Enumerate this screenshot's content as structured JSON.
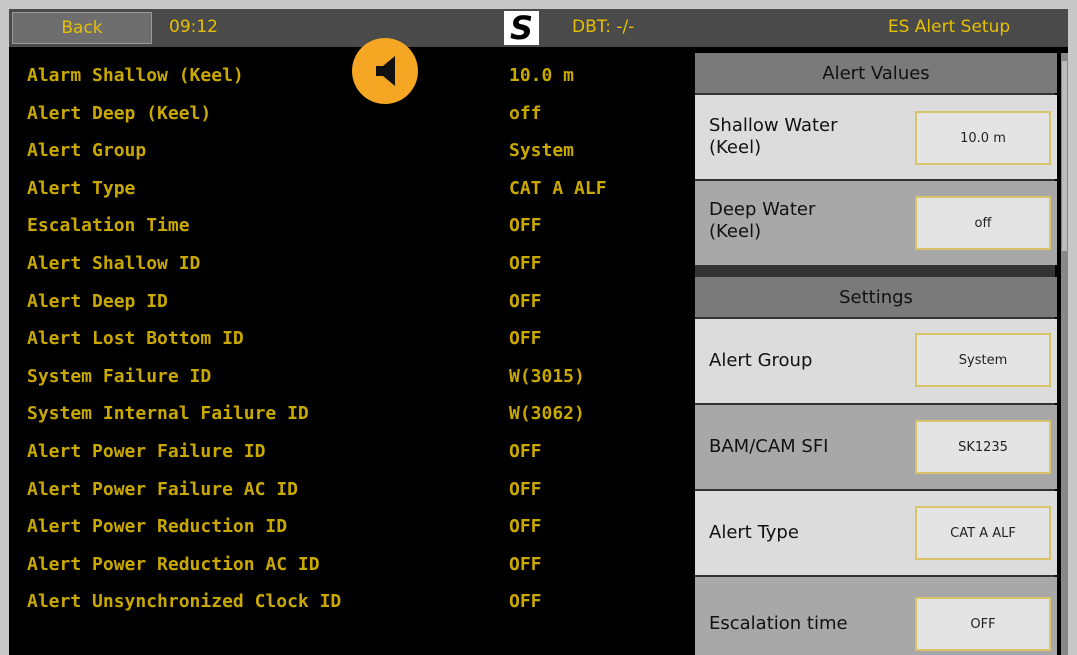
{
  "topbar": {
    "back_label": "Back",
    "time": "09:12",
    "logo": "S",
    "dbt": "DBT: -/-",
    "title": "ES Alert Setup"
  },
  "speaker": {
    "icon": "speaker-icon",
    "color": "#f5a623"
  },
  "list": [
    {
      "label": "Alarm Shallow (Keel)",
      "value": "10.0 m"
    },
    {
      "label": "Alert Deep (Keel)",
      "value": "off"
    },
    {
      "label": "Alert Group",
      "value": "System"
    },
    {
      "label": "Alert Type",
      "value": "CAT A ALF"
    },
    {
      "label": "Escalation Time",
      "value": "OFF"
    },
    {
      "label": "Alert Shallow ID",
      "value": "OFF"
    },
    {
      "label": "Alert Deep ID",
      "value": "OFF"
    },
    {
      "label": "Alert Lost Bottom ID",
      "value": "OFF"
    },
    {
      "label": "System Failure ID",
      "value": "W(3015)"
    },
    {
      "label": "System Internal Failure ID",
      "value": "W(3062)"
    },
    {
      "label": "Alert Power Failure ID",
      "value": "OFF"
    },
    {
      "label": "Alert Power Failure AC ID",
      "value": "OFF"
    },
    {
      "label": "Alert Power Reduction ID",
      "value": "OFF"
    },
    {
      "label": "Alert Power Reduction AC ID",
      "value": "OFF"
    },
    {
      "label": "Alert Unsynchronized Clock ID",
      "value": "OFF"
    }
  ],
  "panel": {
    "alert_values_header": "Alert Values",
    "shallow_label": "Shallow Water\n(Keel)",
    "shallow_value": "10.0 m",
    "deep_label": "Deep Water\n(Keel)",
    "deep_value": "off",
    "settings_header": "Settings",
    "group_label": "Alert Group",
    "group_value": "System",
    "bam_label": "BAM/CAM SFI",
    "bam_value": "SK1235",
    "type_label": "Alert Type",
    "type_value": "CAT A ALF",
    "escalation_label": "Escalation time",
    "escalation_value": "OFF"
  },
  "colors": {
    "text_accent": "#c9a800",
    "background": "#000000",
    "button_border": "#d9c46a"
  }
}
